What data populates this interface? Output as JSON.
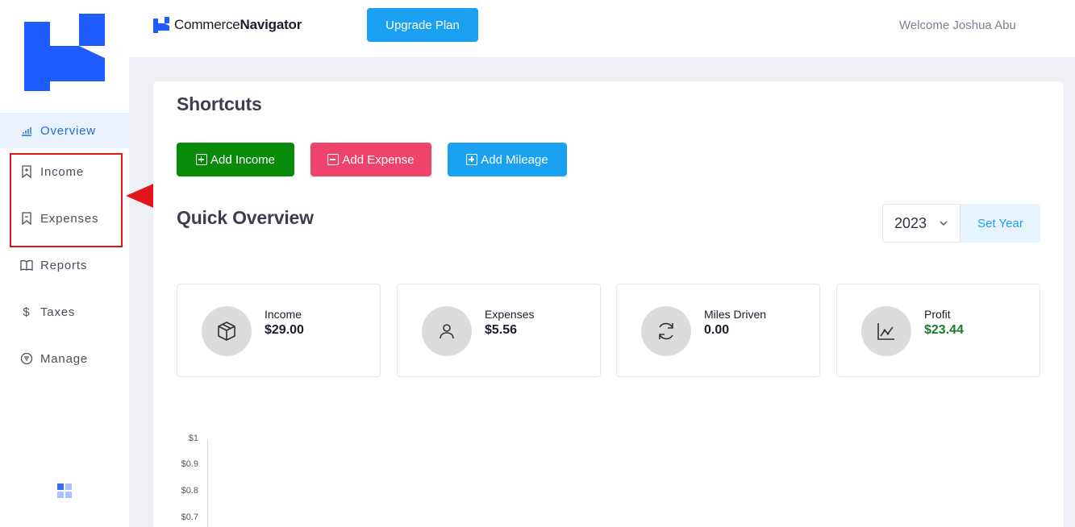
{
  "sidebar": {
    "items": [
      {
        "label": "Overview",
        "icon": "bar-chart-icon",
        "active": true
      },
      {
        "label": "Income",
        "icon": "bookmark-icon"
      },
      {
        "label": "Expenses",
        "icon": "bookmark-icon"
      },
      {
        "label": "Reports",
        "icon": "book-icon"
      },
      {
        "label": "Taxes",
        "icon": "dollar-icon"
      },
      {
        "label": "Manage",
        "icon": "filter-circle-icon"
      }
    ]
  },
  "header": {
    "brand_prefix": "Commerce",
    "brand_suffix": "Navigator",
    "upgrade_label": "Upgrade Plan",
    "welcome": "Welcome Joshua Abu"
  },
  "shortcuts": {
    "title": "Shortcuts",
    "add_income": "Add Income",
    "add_expense": "Add Expense",
    "add_mileage": "Add Mileage"
  },
  "overview": {
    "title": "Quick Overview",
    "year": "2023",
    "set_year_label": "Set Year",
    "stats": [
      {
        "label": "Income",
        "value": "$29.00",
        "icon": "box-icon"
      },
      {
        "label": "Expenses",
        "value": "$5.56",
        "icon": "user-icon"
      },
      {
        "label": "Miles Driven",
        "value": "0.00",
        "icon": "refresh-icon"
      },
      {
        "label": "Profit",
        "value": "$23.44",
        "icon": "line-chart-icon"
      }
    ]
  },
  "chart_data": {
    "type": "bar",
    "y_ticks": [
      "$1",
      "$0.9",
      "$0.8",
      "$0.7"
    ]
  },
  "colors": {
    "brand_blue": "#1e5cff",
    "upgrade": "#1ba1f2",
    "add_income": "#0a8a0a",
    "add_expense": "#f0436b",
    "add_mileage": "#1ba1f2",
    "profit_value": "#1a7a2e",
    "highlight": "#e0161b"
  }
}
